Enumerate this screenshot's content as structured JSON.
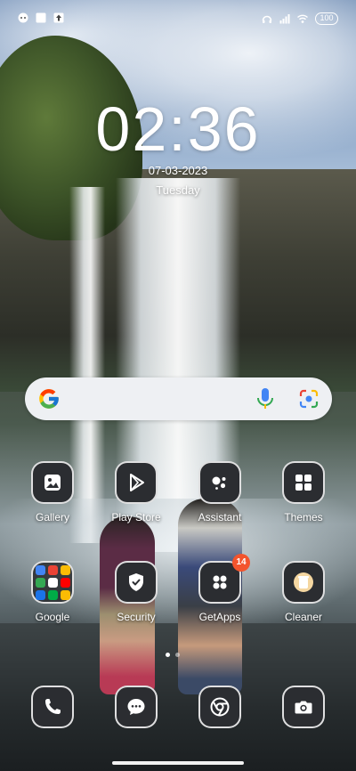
{
  "status_bar": {
    "left_icons": [
      "chat-bubble-icon",
      "square-icon",
      "upload-icon"
    ],
    "right_icons": [
      "headset-icon",
      "signal-icon",
      "wifi-icon"
    ],
    "battery": "100"
  },
  "clock": {
    "time": "02:36",
    "date": "07-03-2023",
    "weekday": "Tuesday"
  },
  "search": {
    "icons": [
      "google-logo",
      "mic-icon",
      "lens-icon"
    ]
  },
  "apps": [
    {
      "label": "Gallery",
      "icon": "gallery-icon"
    },
    {
      "label": "Play Store",
      "icon": "play-store-icon"
    },
    {
      "label": "Assistant",
      "icon": "assistant-icon"
    },
    {
      "label": "Themes",
      "icon": "themes-icon"
    },
    {
      "label": "Google",
      "icon": "folder-icon"
    },
    {
      "label": "Security",
      "icon": "shield-icon"
    },
    {
      "label": "GetApps",
      "icon": "getapps-icon",
      "badge": "14"
    },
    {
      "label": "Cleaner",
      "icon": "cleaner-icon"
    }
  ],
  "dock": [
    {
      "icon": "phone-icon"
    },
    {
      "icon": "messages-icon"
    },
    {
      "icon": "chrome-icon"
    },
    {
      "icon": "camera-icon"
    }
  ],
  "page_indicator": {
    "pages": 2,
    "active": 1
  },
  "colors": {
    "badge": "#f3542d",
    "tile_bg": "#2b2d31",
    "search_bg": "#eef0f3"
  }
}
